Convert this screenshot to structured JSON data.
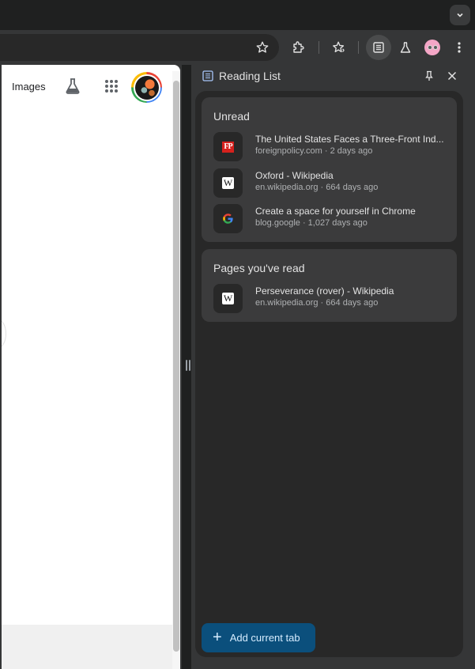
{
  "browser": {
    "tab_search_icon": "chevron-down-icon",
    "toolbar_icons": [
      "bookmark-star-icon",
      "extensions-icon",
      "bookmarks-star-icon",
      "reading-list-icon",
      "labs-flask-icon",
      "profile-avatar",
      "more-menu-icon"
    ]
  },
  "page": {
    "images_link": "Images",
    "labs_icon": "flask-icon",
    "apps_icon": "apps-grid-icon"
  },
  "reading_list": {
    "title": "Reading List",
    "pin_icon": "pin-icon",
    "close_icon": "close-icon",
    "unread": {
      "heading": "Unread",
      "items": [
        {
          "title": "The United States Faces a Three-Front Ind...",
          "source": "foreignpolicy.com",
          "age": "2 days ago",
          "favicon": "FP"
        },
        {
          "title": "Oxford - Wikipedia",
          "source": "en.wikipedia.org",
          "age": "664 days ago",
          "favicon": "W"
        },
        {
          "title": "Create a space for yourself in Chrome",
          "source": "blog.google",
          "age": "1,027 days ago",
          "favicon": "G"
        }
      ]
    },
    "read": {
      "heading": "Pages you've read",
      "items": [
        {
          "title": "Perseverance (rover) - Wikipedia",
          "source": "en.wikipedia.org",
          "age": "664 days ago",
          "favicon": "W"
        }
      ]
    },
    "add_button": {
      "icon": "+",
      "label": "Add current tab"
    },
    "accent_color": "#0b4f7c"
  }
}
